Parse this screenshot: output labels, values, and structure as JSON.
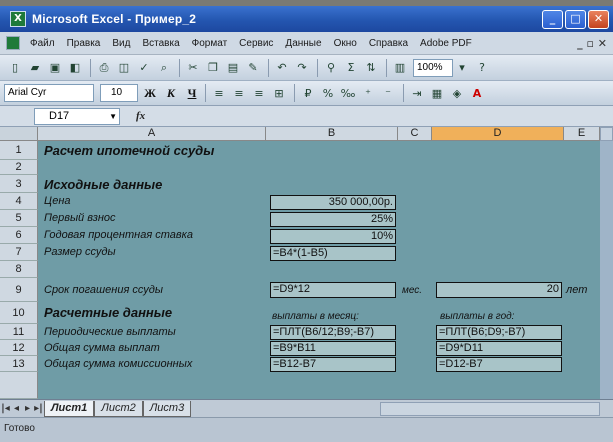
{
  "window": {
    "title": "Microsoft Excel - Пример_2",
    "minimize": "_",
    "maximize": "□",
    "close": "✕"
  },
  "menu": [
    "Файл",
    "Правка",
    "Вид",
    "Вставка",
    "Формат",
    "Сервис",
    "Данные",
    "Окно",
    "Справка",
    "Adobe PDF"
  ],
  "menu_right": "_ ▫ ✕",
  "toolbar": {
    "zoom": "100%"
  },
  "format_bar": {
    "font": "Arial Cyr",
    "size": "10",
    "bold": "Ж",
    "italic": "К",
    "underline": "Ч"
  },
  "name_box": "D17",
  "fx": "fx",
  "columns": [
    "A",
    "B",
    "C",
    "D",
    "E"
  ],
  "rows": [
    "1",
    "2",
    "3",
    "4",
    "5",
    "6",
    "7",
    "8",
    "9",
    "10",
    "11",
    "12",
    "13"
  ],
  "cells": {
    "a1": "Расчет ипотечной ссуды",
    "a3": "Исходные данные",
    "a4": "Цена",
    "a5": "Первый взнос",
    "a6": "Годовая процентная ставка",
    "a7": "Размер ссуды",
    "a9": "Срок погашения ссуды",
    "a10": "Расчетные данные",
    "a11": "Периодические выплаты",
    "a12": "Общая сумма выплат",
    "a13": "Общая сумма комиссионных",
    "b4": "350 000,00р.",
    "b5": "25%",
    "b6": "10%",
    "b7": "=B4*(1-B5)",
    "b9": "=D9*12",
    "c9": "мес.",
    "d9": "20",
    "e9": "лет",
    "b10": "выплаты в месяц:",
    "d10": "выплаты в год:",
    "b11": "=ПЛТ(B6/12;B9;-B7)",
    "d11": "=ПЛТ(B6;D9;-B7)",
    "b12": "=B9*B11",
    "d12": "=D9*D11",
    "b13": "=B12-B7",
    "d13": "=D12-B7"
  },
  "sheets": [
    "Лист1",
    "Лист2",
    "Лист3"
  ],
  "status": "Готово"
}
